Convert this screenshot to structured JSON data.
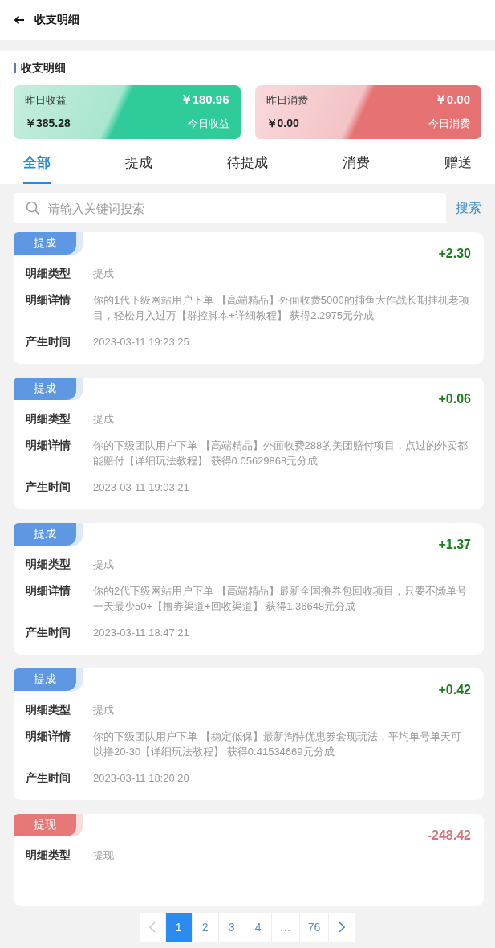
{
  "header": {
    "title": "收支明细"
  },
  "section_title": "收支明细",
  "summary_cards": [
    {
      "kind": "income",
      "yesterday_label": "昨日收益",
      "yesterday_value": "￥385.28",
      "today_value": "￥180.96",
      "today_label": "今日收益"
    },
    {
      "kind": "expense",
      "yesterday_label": "昨日消费",
      "yesterday_value": "￥0.00",
      "today_value": "￥0.00",
      "today_label": "今日消费"
    }
  ],
  "tabs": [
    {
      "label": "全部",
      "selected": true
    },
    {
      "label": "提成",
      "selected": false
    },
    {
      "label": "待提成",
      "selected": false
    },
    {
      "label": "消费",
      "selected": false
    },
    {
      "label": "赠送",
      "selected": false
    }
  ],
  "search": {
    "placeholder": "请输入关键词搜索",
    "button": "搜索"
  },
  "records": [
    {
      "kind": "commission",
      "badge": "提成",
      "amount": "+2.30",
      "rows": [
        {
          "label": "明细类型",
          "value": "提成"
        },
        {
          "label": "明细详情",
          "value": "你的1代下级网站用户下单 【高端精品】外面收费5000的捕鱼大作战长期挂机老项目，轻松月入过万【群控脚本+详细教程】 获得2.2975元分成"
        },
        {
          "label": "产生时间",
          "value": "2023-03-11 19:23:25"
        }
      ]
    },
    {
      "kind": "commission",
      "badge": "提成",
      "amount": "+0.06",
      "rows": [
        {
          "label": "明细类型",
          "value": "提成"
        },
        {
          "label": "明细详情",
          "value": "你的下级团队用户下单 【高端精品】外面收费288的美团赔付项目，点过的外卖都能赔付【详细玩法教程】 获得0.05629868元分成"
        },
        {
          "label": "产生时间",
          "value": "2023-03-11 19:03:21"
        }
      ]
    },
    {
      "kind": "commission",
      "badge": "提成",
      "amount": "+1.37",
      "rows": [
        {
          "label": "明细类型",
          "value": "提成"
        },
        {
          "label": "明细详情",
          "value": "你的2代下级网站用户下单 【高端精品】最新全国撸券包回收项目，只要不懒单号一天最少50+【撸券渠道+回收渠道】 获得1.36648元分成"
        },
        {
          "label": "产生时间",
          "value": "2023-03-11 18:47:21"
        }
      ]
    },
    {
      "kind": "commission",
      "badge": "提成",
      "amount": "+0.42",
      "rows": [
        {
          "label": "明细类型",
          "value": "提成"
        },
        {
          "label": "明细详情",
          "value": "你的下级团队用户下单 【稳定低保】最新淘特优惠券套现玩法，平均单号单天可以撸20-30【详细玩法教程】 获得0.41534669元分成"
        },
        {
          "label": "产生时间",
          "value": "2023-03-11 18:20:20"
        }
      ]
    },
    {
      "kind": "withdraw",
      "badge": "提现",
      "amount": "-248.42",
      "rows": [
        {
          "label": "明细类型",
          "value": "提现"
        }
      ]
    }
  ],
  "pagination": {
    "prev_disabled": true,
    "pages": [
      {
        "label": "1",
        "selected": true
      },
      {
        "label": "2",
        "selected": false
      },
      {
        "label": "3",
        "selected": false
      },
      {
        "label": "4",
        "selected": false
      },
      {
        "label": "…",
        "kind": "ellipsis",
        "selected": false
      },
      {
        "label": "76",
        "selected": false
      }
    ]
  }
}
